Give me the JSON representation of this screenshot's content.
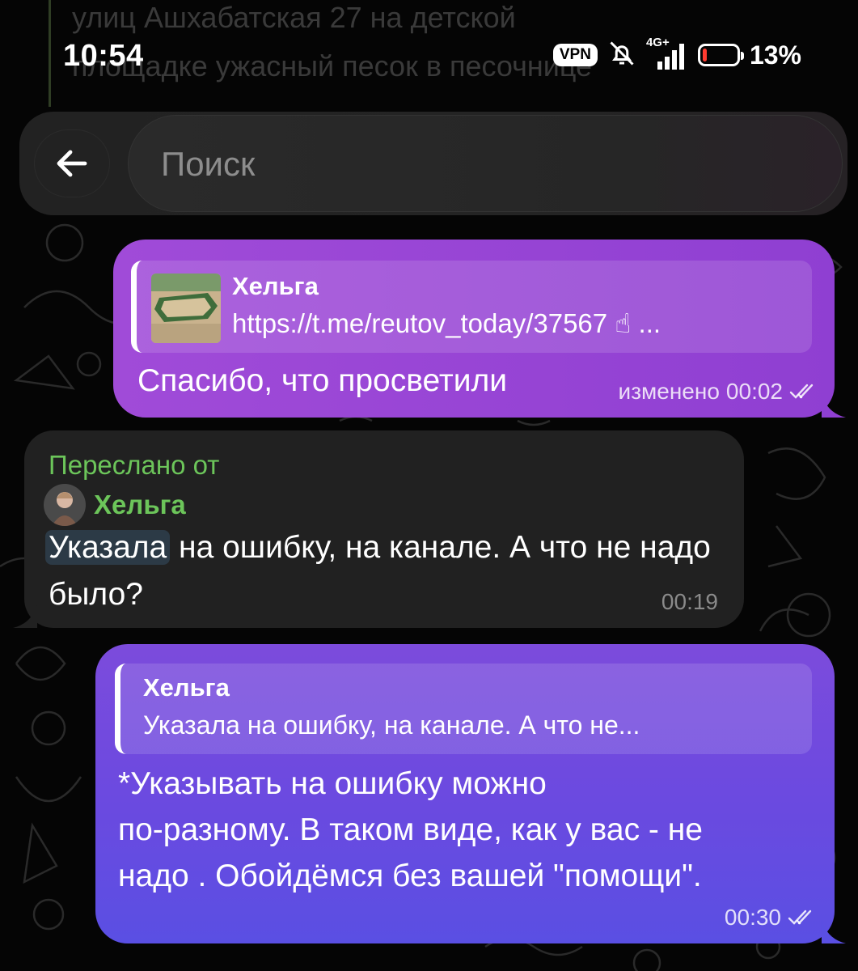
{
  "status_bar": {
    "time": "10:54",
    "vpn": "VPN",
    "network": "4G+",
    "battery_percent": "13%",
    "battery_level": 0.13,
    "battery_color": "#ff3b30"
  },
  "background_message": {
    "line1": "улиц Ашхабатская 27 на детской",
    "line2": "площадке ужасный песок в песочнице"
  },
  "search": {
    "placeholder": "Поиск"
  },
  "messages": [
    {
      "direction": "outgoing",
      "reply": {
        "name": "Хельга",
        "text": "https://t.me/reutov_today/37567 ☝ ..."
      },
      "text": "Спасибо, что просветили",
      "edited_label": "изменено",
      "time": "00:02",
      "status_icon": "double-check-icon"
    },
    {
      "direction": "incoming",
      "forwarded_label": "Переслано от",
      "forwarded_from": "Хельга",
      "highlight": "Указала",
      "text_rest": " на ошибку,  на канале. А что не надо было?",
      "time": "00:19"
    },
    {
      "direction": "outgoing",
      "reply": {
        "name": "Хельга",
        "text": "Указала на ошибку,  на канале. А что не..."
      },
      "line1": "*Указывать на ошибку можно",
      "line2": "по-разному. В таком виде, как у вас -  не",
      "line3": "надо . Обойдёмся без вашей \"помощи\".",
      "time": "00:30",
      "status_icon": "double-check-icon"
    }
  ],
  "colors": {
    "outgoing_1": "#9b47d6",
    "outgoing_2": "#6a4ae0",
    "incoming": "#212121",
    "forward_green": "#6cc55a"
  }
}
